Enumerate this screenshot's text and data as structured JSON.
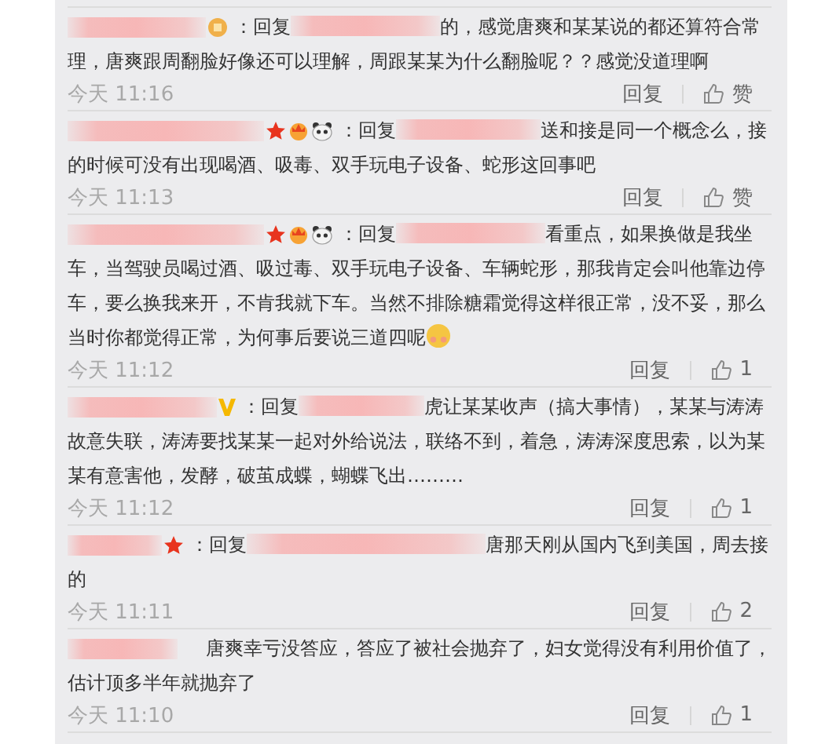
{
  "comments": [
    {
      "badges": [
        {
          "kind": "medal"
        }
      ],
      "reply_label": "：回复",
      "text": "的，感觉唐爽和某某说的都还算符合常理，唐爽跟周翻脸好像还可以理解，周跟某某为什么翻脸呢？？感觉没道理啊",
      "emoji": false,
      "time": "今天 11:16",
      "reply_action": "回复",
      "like": "赞"
    },
    {
      "badges": [
        {
          "kind": "star"
        },
        {
          "kind": "crown"
        },
        {
          "kind": "panda"
        }
      ],
      "reply_label": "：回复",
      "text": "送和接是同一个概念么，接的时候可没有出现喝酒、吸毒、双手玩电子设备、蛇形这回事吧",
      "emoji": false,
      "time": "今天 11:13",
      "reply_action": "回复",
      "like": "赞"
    },
    {
      "badges": [
        {
          "kind": "star"
        },
        {
          "kind": "crown"
        },
        {
          "kind": "panda"
        }
      ],
      "reply_label": "：回复",
      "text": "看重点，如果换做是我坐车，当驾驶员喝过酒、吸过毒、双手玩电子设备、车辆蛇形，那我肯定会叫他靠边停车，要么换我来开，不肯我就下车。当然不排除糖霜觉得这样很正常，没不妥，那么当时你都觉得正常，为何事后要说三道四呢",
      "emoji": true,
      "time": "今天 11:12",
      "reply_action": "回复",
      "like": "1"
    },
    {
      "badges": [
        {
          "kind": "vip"
        }
      ],
      "reply_label": "：回复",
      "text": "虎让某某收声（搞大事情），某某与涛涛故意失联，涛涛要找某某一起对外给说法，联络不到，着急，涛涛深度思索，以为某某有意害他，发酵，破茧成蝶，蝴蝶飞出………",
      "emoji": false,
      "time": "今天 11:12",
      "reply_action": "回复",
      "like": "1"
    },
    {
      "badges": [
        {
          "kind": "star"
        }
      ],
      "reply_label": "：回复",
      "text": "唐那天刚从国内飞到美国，周去接的",
      "emoji": false,
      "time": "今天 11:11",
      "reply_action": "回复",
      "like": "2"
    },
    {
      "text": "唐爽幸亏没答应，答应了被社会抛弃了，妇女觉得没有利用价值了，估计顶多半年就抛弃了",
      "emoji": false,
      "time": "今天 11:10",
      "reply_action": "回复",
      "like": "1"
    }
  ]
}
